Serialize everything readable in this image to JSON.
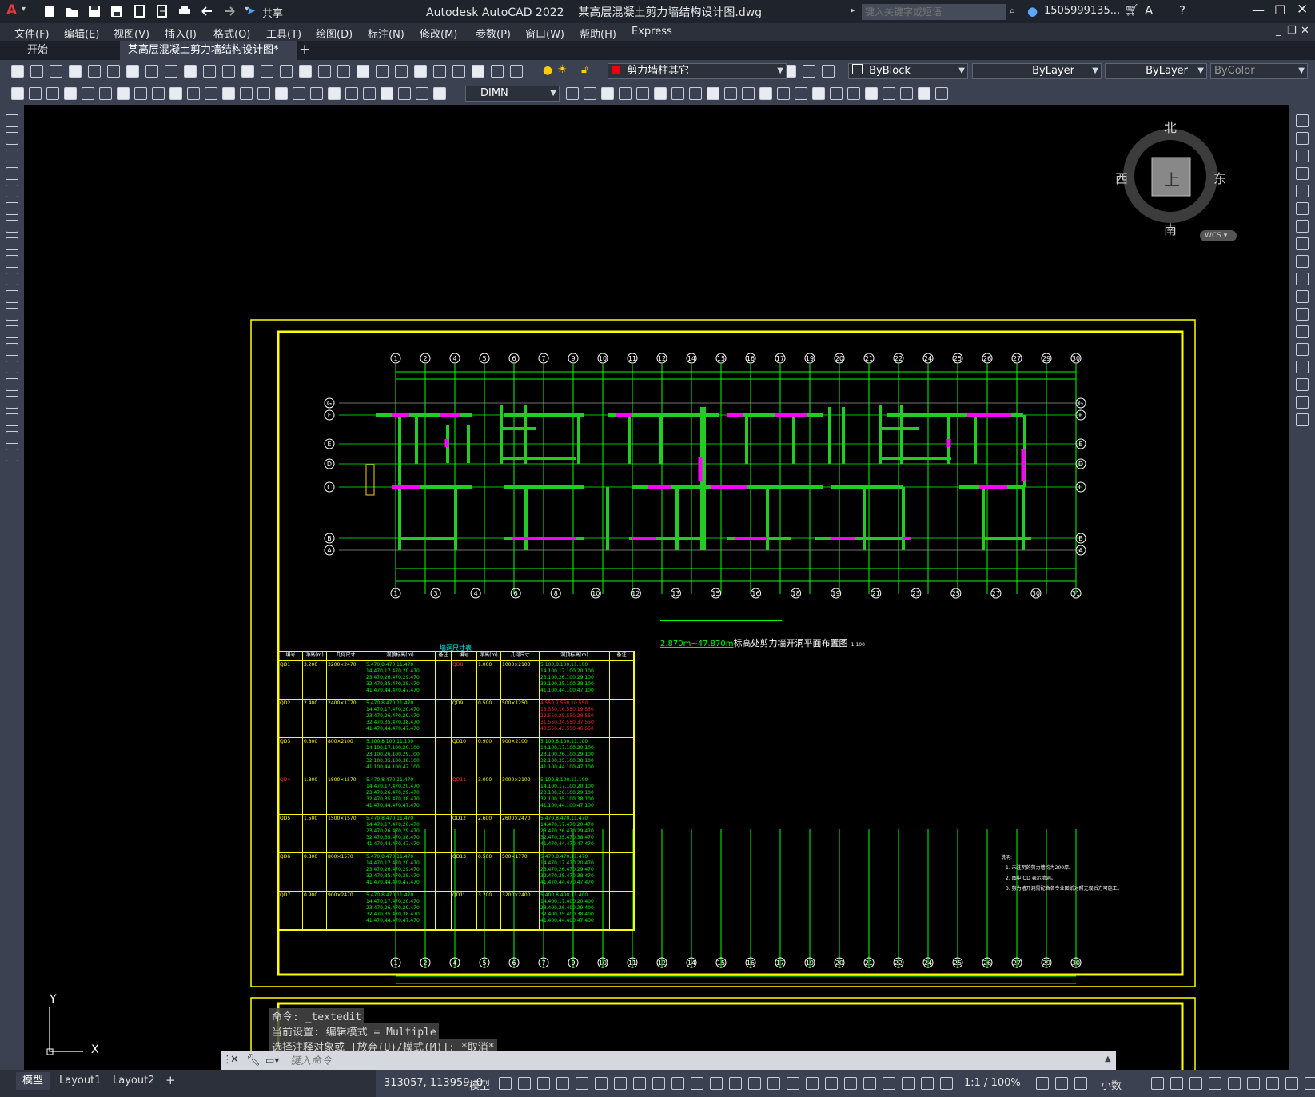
{
  "app": {
    "title": "Autodesk AutoCAD 2022    某高层混凝土剪力墙结构设计图.dwg",
    "share_label": "共享",
    "search_placeholder": "键入关键字或短语",
    "user": "1505999135...",
    "logo": "A"
  },
  "menu": [
    "文件(F)",
    "编辑(E)",
    "视图(V)",
    "插入(I)",
    "格式(O)",
    "工具(T)",
    "绘图(D)",
    "标注(N)",
    "修改(M)",
    "参数(P)",
    "窗口(W)",
    "帮助(H)",
    "Express"
  ],
  "tabs": [
    {
      "label": "开始"
    },
    {
      "label": "某高层混凝土剪力墙结构设计图*",
      "close": "×"
    }
  ],
  "toolbar": {
    "layer_name": "剪力墙柱其它",
    "color": "ByBlock",
    "linetype": "ByLayer",
    "lineweight": "ByLayer",
    "plotstyle": "ByColor",
    "dimstyle": "DIMN"
  },
  "viewcube": {
    "north": "北",
    "south": "南",
    "east": "东",
    "west": "西",
    "face": "上",
    "wcs": "WCS"
  },
  "drawing": {
    "plan_title_prefix": "2.870m~47.870m",
    "plan_title": "标高处剪力墙开洞平面布置图",
    "plan_scale": "1:100",
    "axis_top": [
      "1",
      "2",
      "4",
      "5",
      "6",
      "7",
      "9",
      "10",
      "11",
      "12",
      "14",
      "15",
      "16",
      "17",
      "19",
      "20",
      "21",
      "22",
      "24",
      "25",
      "26",
      "27",
      "29",
      "30"
    ],
    "axis_bottom": [
      "1",
      "3",
      "4",
      "6",
      "8",
      "10",
      "12",
      "13",
      "15",
      "16",
      "18",
      "19",
      "21",
      "23",
      "25",
      "27",
      "30",
      "31"
    ],
    "axis_side": [
      "G",
      "F",
      "E",
      "D",
      "C",
      "B",
      "A"
    ],
    "table_title": "墙洞尺寸表",
    "table_headers": [
      "编号",
      "净高(m)",
      "几何尺寸",
      "洞顶标高(m)",
      "备注",
      "编号",
      "净高(m)",
      "几何尺寸",
      "洞顶标高(m)",
      "备注"
    ],
    "table_rows": [
      {
        "id": "QD1",
        "h": "3.200",
        "size": "3200×2470",
        "elev": [
          "5.470,8.470,11.470",
          "14.470,17.470,20.470",
          "23.470,26.470,29.470",
          "32.470,35.470,38.470",
          "41.470,44.470,47.470"
        ],
        "id2": "QD8",
        "h2": "1.000",
        "size2": "1000×2100",
        "elev2": [
          "5.100,8.100,11.100",
          "14.100,17.100,20.100",
          "23.100,26.100,29.100",
          "32.100,35.100,38.100",
          "41.100,44.100,47.100"
        ],
        "red1": false,
        "red2": true
      },
      {
        "id": "QD2",
        "h": "2.400",
        "size": "2400×1770",
        "elev": [
          "5.470,8.470,11.470",
          "14.470,17.470,20.470",
          "23.470,26.470,29.470",
          "32.470,35.470,38.470",
          "41.470,44.470,47.470"
        ],
        "id2": "QD9",
        "h2": "0.500",
        "size2": "500×1250",
        "elev2": [
          "4.550,7.550,10.550",
          "13.550,16.550,19.550",
          "22.550,25.550,28.550",
          "31.550,34.550,37.550",
          "40.550,43.550,46.550"
        ],
        "red1": false,
        "red2": false,
        "redElev2": true
      },
      {
        "id": "QD3",
        "h": "0.800",
        "size": "800×2100",
        "elev": [
          "5.100,8.100,11.100",
          "14.100,17.100,20.100",
          "23.100,26.100,29.100",
          "32.100,35.100,38.100",
          "41.100,44.100,47.100"
        ],
        "id2": "QD10",
        "h2": "0.900",
        "size2": "900×2100",
        "elev2": [
          "5.100,8.100,11.100",
          "14.100,17.100,20.100",
          "23.100,26.100,29.100",
          "32.100,35.100,38.100",
          "41.100,44.100,47.100"
        ],
        "red1": false,
        "red2": false
      },
      {
        "id": "QD4",
        "h": "1.800",
        "size": "1800×1570",
        "elev": [
          "5.470,8.470,11.470",
          "14.470,17.470,20.470",
          "23.470,26.470,29.470",
          "32.470,35.470,38.470",
          "41.470,44.470,47.470"
        ],
        "id2": "QD11",
        "h2": "3.000",
        "size2": "3000×2100",
        "elev2": [
          "5.100,8.100,11.100",
          "14.100,17.100,20.100",
          "23.100,26.100,29.100",
          "32.100,35.100,38.100",
          "41.100,44.100,47.100"
        ],
        "red1": true,
        "red2": true
      },
      {
        "id": "QD5",
        "h": "1.500",
        "size": "1500×1570",
        "elev": [
          "5.470,8.470,11.470",
          "14.470,17.470,20.470",
          "23.470,26.470,29.470",
          "32.470,35.470,38.470",
          "41.470,44.470,47.470"
        ],
        "id2": "QD12",
        "h2": "2.600",
        "size2": "2600×2470",
        "elev2": [
          "5.470,8.470,11.470",
          "14.470,17.470,20.470",
          "23.470,26.470,29.470",
          "32.470,35.470,38.470",
          "41.470,44.470,47.470"
        ],
        "red1": false,
        "red2": false
      },
      {
        "id": "QD6",
        "h": "0.800",
        "size": "800×1570",
        "elev": [
          "5.470,8.470,11.470",
          "14.470,17.470,20.470",
          "23.470,26.470,29.470",
          "32.470,35.470,38.470",
          "41.470,44.470,47.470"
        ],
        "id2": "QD13",
        "h2": "0.500",
        "size2": "500×1770",
        "elev2": [
          "5.470,8.470,11.470",
          "14.470,17.470,20.470",
          "23.470,26.470,29.470",
          "32.470,35.470,38.470",
          "41.470,44.470,47.470"
        ],
        "red1": false,
        "red2": false
      },
      {
        "id": "QD7",
        "h": "0.900",
        "size": "900×2470",
        "elev": [
          "5.470,8.470,11.470",
          "14.470,17.470,20.470",
          "23.470,26.470,29.470",
          "32.470,35.470,38.470",
          "41.470,44.470,47.470"
        ],
        "id2": "QD1'",
        "h2": "3.200",
        "size2": "3200×2400",
        "elev2": [
          "5.400,8.400,11.400",
          "14.400,17.400,20.400",
          "23.400,26.400,29.400",
          "32.400,35.400,38.400",
          "41.400,44.400,47.400"
        ],
        "red1": false,
        "red2": false
      }
    ],
    "notes_title": "说明:",
    "notes": [
      "1. 未注明的剪力墙均为200厚。",
      "2. 图中 QD 表示墙洞。",
      "3. 剪力墙开洞需配合各专业图纸对照无误后方可施工。"
    ]
  },
  "command": {
    "history": [
      "命令: _textedit",
      "当前设置: 编辑模式 = Multiple",
      "选择注释对象或 [放弃(U)/模式(M)]: *取消*"
    ],
    "placeholder": "键入命令"
  },
  "status": {
    "layout_tabs": [
      "模型",
      "Layout1",
      "Layout2"
    ],
    "coords": "313057, 113959, 0",
    "mode": "模型",
    "scale": "1:1 / 100%",
    "units": "小数",
    "ucs_x": "X",
    "ucs_y": "Y"
  }
}
